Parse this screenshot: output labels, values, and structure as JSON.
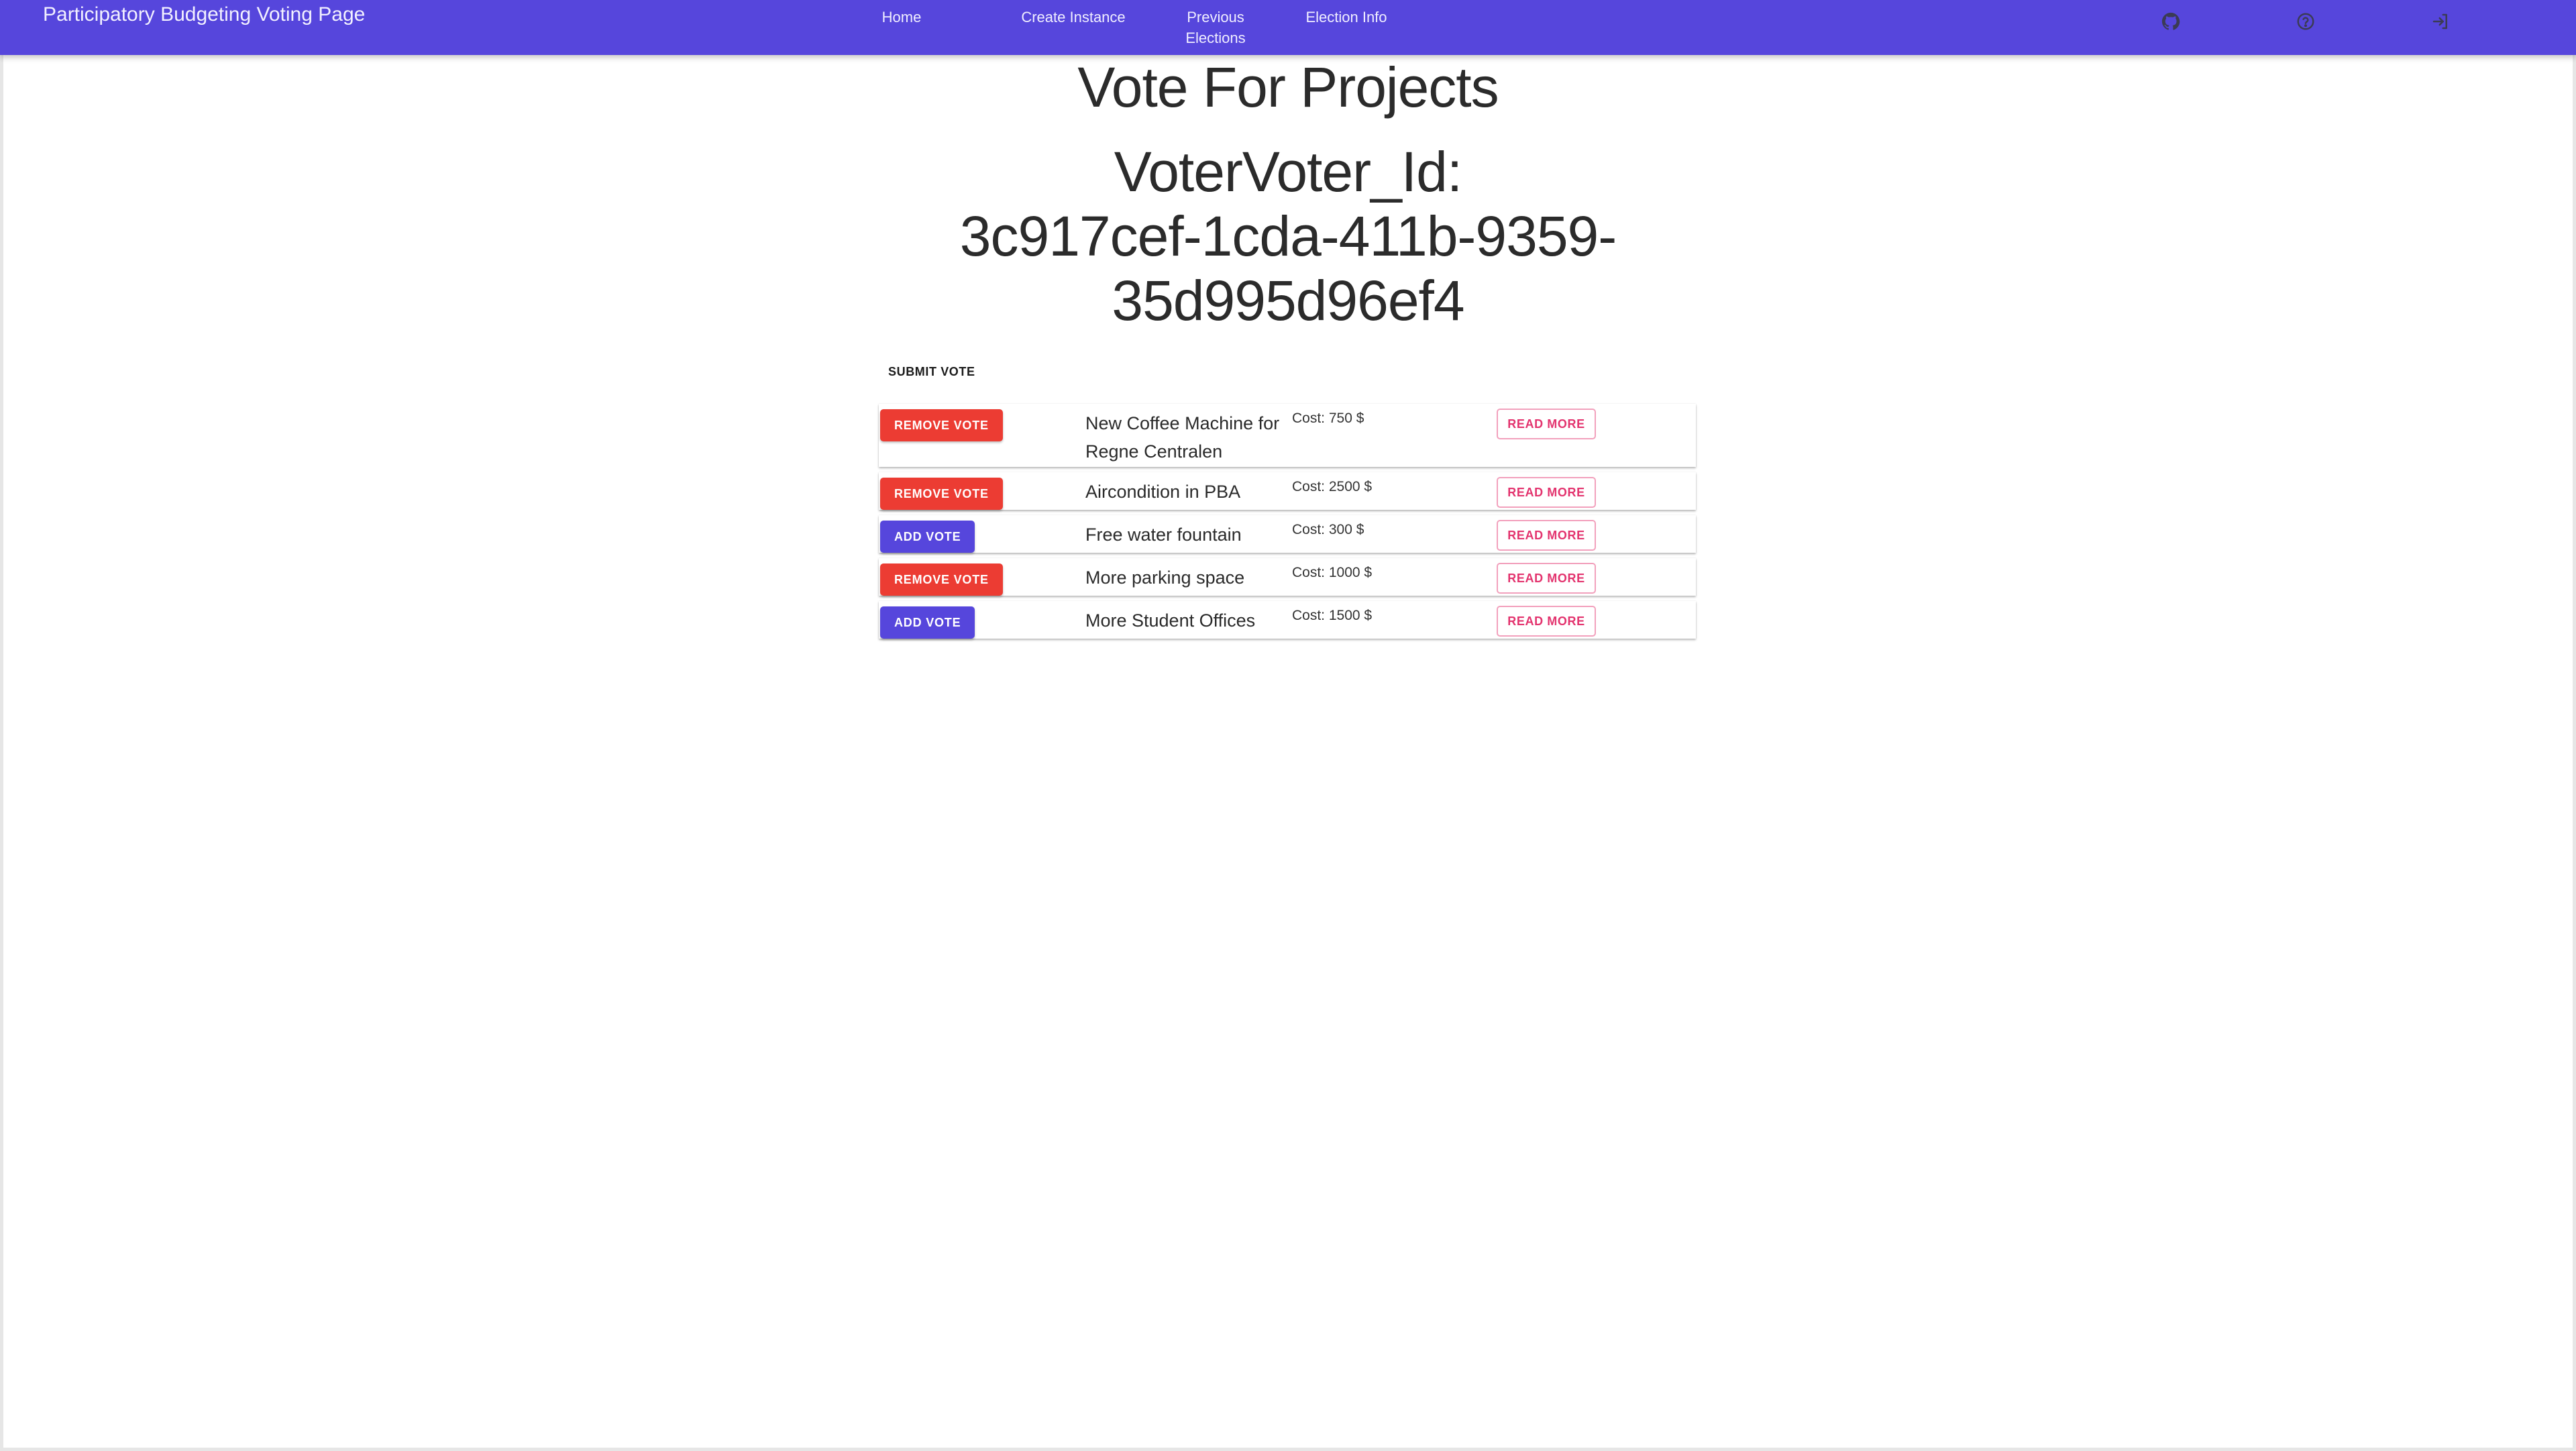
{
  "header": {
    "brand": "Participatory Budgeting Voting Page",
    "nav": {
      "home": "Home",
      "create": "Create Instance",
      "previous_line1": "Previous",
      "previous_line2": "Elections",
      "info": "Election Info"
    },
    "icons": [
      "github-icon",
      "help-circle-icon",
      "login-icon"
    ],
    "color": "#5646dc"
  },
  "main": {
    "title": "Vote For Projects",
    "voter_line1": "VoterVoter_Id:",
    "voter_line2": "3c917cef-1cda-411b-9359-",
    "voter_line3": "35d995d96ef4",
    "submit_label": "SUBMIT VOTE"
  },
  "projects": [
    {
      "vote_label": "REMOVE VOTE",
      "name": "New Coffee Machine for Regne Centralen",
      "cost": "Cost: 750 $",
      "read_more": "READ MORE"
    },
    {
      "vote_label": "REMOVE VOTE",
      "name": "Aircondition in PBA",
      "cost": "Cost: 2500 $",
      "read_more": "READ MORE"
    },
    {
      "vote_label": "ADD VOTE",
      "name": "Free water fountain",
      "cost": "Cost: 300 $",
      "read_more": "READ MORE"
    },
    {
      "vote_label": "REMOVE VOTE",
      "name": "More parking space",
      "cost": "Cost: 1000 $",
      "read_more": "READ MORE"
    },
    {
      "vote_label": "ADD VOTE",
      "name": "More Student Offices",
      "cost": "Cost: 1500 $",
      "read_more": "READ MORE"
    }
  ],
  "colors": {
    "remove": "#ec3c33",
    "add": "#5646dc",
    "read_more": "#e3336e"
  }
}
